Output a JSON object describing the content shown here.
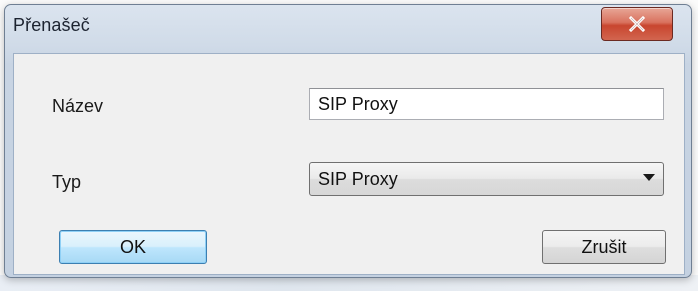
{
  "window": {
    "title": "Přenašeč",
    "close_icon": "close-icon"
  },
  "form": {
    "name_label": "Název",
    "name_value": "SIP Proxy",
    "type_label": "Typ",
    "type_selected": "SIP Proxy",
    "type_arrow_icon": "chevron-down-icon"
  },
  "buttons": {
    "ok_label": "OK",
    "cancel_label": "Zrušit"
  },
  "colors": {
    "close_button": "#c8462f",
    "default_button_border": "#3c7fb1",
    "frame": "#c4d1e1"
  }
}
